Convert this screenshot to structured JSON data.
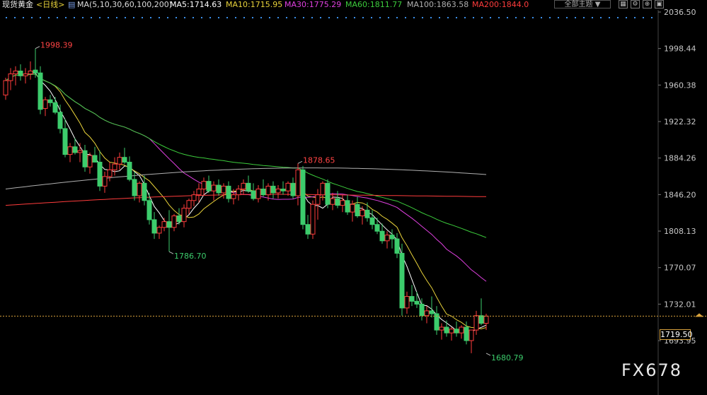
{
  "header": {
    "instrument": "现货黄金",
    "period": "<日线>",
    "ma_label": "MA(5,10,30,60,100,200)",
    "ma_values": [
      {
        "text": "MA5:1714.63",
        "color": "#ffffff"
      },
      {
        "text": "MA10:1715.95",
        "color": "#e8d23a"
      },
      {
        "text": "MA30:1775.29",
        "color": "#e040e0"
      },
      {
        "text": "MA60:1811.77",
        "color": "#3ccc3c"
      },
      {
        "text": "MA100:1863.58",
        "color": "#b0b0b0"
      },
      {
        "text": "MA200:1844.0",
        "color": "#ff3c3c"
      }
    ],
    "mode_button": "全部主题",
    "mode_arrow": "▼",
    "icons": [
      "layout-icon",
      "settings-icon",
      "zoom-icon",
      "fullscreen-icon"
    ],
    "icon_glyphs": [
      "▦",
      "⚙",
      "⊕",
      "▣"
    ]
  },
  "watermark": "FX678",
  "current_price": "1719.50",
  "colors": {
    "up": "#000000",
    "up_border": "#ff3c3c",
    "down": "#3ccc6c",
    "axis_text": "#c8c8c8",
    "grid_dot": "#3a8ee8",
    "price_line": "#d8a23c"
  },
  "chart_data": {
    "type": "candlestick",
    "y_axis_ticks": [
      "2036.50",
      "1998.44",
      "1960.38",
      "1922.32",
      "1884.26",
      "1846.20",
      "1808.13",
      "1770.07",
      "1732.01",
      "1693.95"
    ],
    "ylim": [
      1680,
      2036.5
    ],
    "annotations": [
      {
        "text": "1998.39",
        "index": 6,
        "price": 1998.39,
        "color": "#ff4444"
      },
      {
        "text": "1786.70",
        "index": 33,
        "price": 1786.7,
        "color": "#3ccc6c"
      },
      {
        "text": "1878.65",
        "index": 59,
        "price": 1878.65,
        "color": "#ff4444"
      },
      {
        "text": "1680.79",
        "index": 97,
        "price": 1680.79,
        "color": "#3ccc6c"
      }
    ],
    "candles": [
      [
        1950,
        1968,
        1945,
        1965
      ],
      [
        1965,
        1978,
        1955,
        1972
      ],
      [
        1972,
        1980,
        1960,
        1975
      ],
      [
        1975,
        1982,
        1965,
        1970
      ],
      [
        1970,
        1978,
        1962,
        1972
      ],
      [
        1972,
        1985,
        1966,
        1975
      ],
      [
        1976,
        1998.39,
        1968,
        1973
      ],
      [
        1973,
        1980,
        1930,
        1935
      ],
      [
        1936,
        1948,
        1928,
        1945
      ],
      [
        1945,
        1950,
        1938,
        1942
      ],
      [
        1942,
        1948,
        1930,
        1932
      ],
      [
        1932,
        1940,
        1910,
        1915
      ],
      [
        1915,
        1925,
        1885,
        1888
      ],
      [
        1888,
        1900,
        1880,
        1896
      ],
      [
        1896,
        1905,
        1888,
        1890
      ],
      [
        1890,
        1900,
        1880,
        1892
      ],
      [
        1892,
        1898,
        1870,
        1875
      ],
      [
        1875,
        1890,
        1868,
        1887
      ],
      [
        1887,
        1896,
        1880,
        1880
      ],
      [
        1880,
        1892,
        1850,
        1855
      ],
      [
        1855,
        1870,
        1848,
        1865
      ],
      [
        1865,
        1880,
        1860,
        1872
      ],
      [
        1872,
        1885,
        1866,
        1878
      ],
      [
        1878,
        1890,
        1872,
        1885
      ],
      [
        1885,
        1895,
        1878,
        1880
      ],
      [
        1880,
        1886,
        1860,
        1862
      ],
      [
        1862,
        1870,
        1840,
        1845
      ],
      [
        1845,
        1860,
        1838,
        1858
      ],
      [
        1858,
        1866,
        1835,
        1840
      ],
      [
        1840,
        1848,
        1815,
        1820
      ],
      [
        1820,
        1828,
        1800,
        1806
      ],
      [
        1806,
        1814,
        1800,
        1812
      ],
      [
        1812,
        1822,
        1808,
        1818
      ],
      [
        1818,
        1830,
        1786.7,
        1812
      ],
      [
        1812,
        1826,
        1808,
        1824
      ],
      [
        1824,
        1832,
        1815,
        1818
      ],
      [
        1818,
        1836,
        1812,
        1832
      ],
      [
        1832,
        1842,
        1826,
        1840
      ],
      [
        1840,
        1850,
        1834,
        1846
      ],
      [
        1846,
        1858,
        1838,
        1852
      ],
      [
        1852,
        1864,
        1846,
        1860
      ],
      [
        1860,
        1866,
        1848,
        1850
      ],
      [
        1850,
        1860,
        1840,
        1856
      ],
      [
        1856,
        1862,
        1845,
        1848
      ],
      [
        1848,
        1858,
        1842,
        1855
      ],
      [
        1855,
        1860,
        1838,
        1842
      ],
      [
        1842,
        1852,
        1836,
        1846
      ],
      [
        1846,
        1856,
        1840,
        1852
      ],
      [
        1852,
        1862,
        1846,
        1858
      ],
      [
        1858,
        1866,
        1848,
        1850
      ],
      [
        1850,
        1858,
        1840,
        1842
      ],
      [
        1842,
        1856,
        1838,
        1852
      ],
      [
        1852,
        1862,
        1844,
        1846
      ],
      [
        1846,
        1858,
        1840,
        1855
      ],
      [
        1855,
        1860,
        1842,
        1848
      ],
      [
        1848,
        1856,
        1842,
        1852
      ],
      [
        1852,
        1860,
        1846,
        1850
      ],
      [
        1850,
        1860,
        1845,
        1858
      ],
      [
        1858,
        1864,
        1842,
        1845
      ],
      [
        1845,
        1878.65,
        1835,
        1872
      ],
      [
        1872,
        1876,
        1810,
        1815
      ],
      [
        1815,
        1825,
        1800,
        1805
      ],
      [
        1805,
        1840,
        1800,
        1836
      ],
      [
        1836,
        1852,
        1820,
        1846
      ],
      [
        1846,
        1860,
        1840,
        1858
      ],
      [
        1858,
        1862,
        1832,
        1836
      ],
      [
        1836,
        1848,
        1830,
        1842
      ],
      [
        1842,
        1850,
        1832,
        1835
      ],
      [
        1835,
        1846,
        1828,
        1840
      ],
      [
        1840,
        1846,
        1825,
        1828
      ],
      [
        1828,
        1840,
        1818,
        1836
      ],
      [
        1836,
        1844,
        1822,
        1824
      ],
      [
        1824,
        1834,
        1815,
        1830
      ],
      [
        1830,
        1838,
        1818,
        1822
      ],
      [
        1822,
        1830,
        1810,
        1815
      ],
      [
        1815,
        1822,
        1805,
        1808
      ],
      [
        1808,
        1816,
        1795,
        1798
      ],
      [
        1798,
        1808,
        1790,
        1804
      ],
      [
        1804,
        1810,
        1790,
        1800
      ],
      [
        1800,
        1806,
        1780,
        1785
      ],
      [
        1785,
        1795,
        1720,
        1728
      ],
      [
        1728,
        1745,
        1722,
        1740
      ],
      [
        1740,
        1752,
        1730,
        1735
      ],
      [
        1735,
        1745,
        1728,
        1732
      ],
      [
        1732,
        1738,
        1715,
        1720
      ],
      [
        1720,
        1730,
        1712,
        1725
      ],
      [
        1725,
        1740,
        1718,
        1722
      ],
      [
        1722,
        1730,
        1700,
        1705
      ],
      [
        1705,
        1712,
        1695,
        1708
      ],
      [
        1708,
        1715,
        1698,
        1702
      ],
      [
        1702,
        1708,
        1694,
        1706
      ],
      [
        1706,
        1714,
        1698,
        1702
      ],
      [
        1702,
        1710,
        1696,
        1708
      ],
      [
        1708,
        1714,
        1690,
        1694
      ],
      [
        1694,
        1700,
        1680.79,
        1705
      ],
      [
        1705,
        1725,
        1700,
        1720
      ],
      [
        1720,
        1738,
        1710,
        1712
      ],
      [
        1712,
        1722,
        1705,
        1719.5
      ]
    ]
  }
}
